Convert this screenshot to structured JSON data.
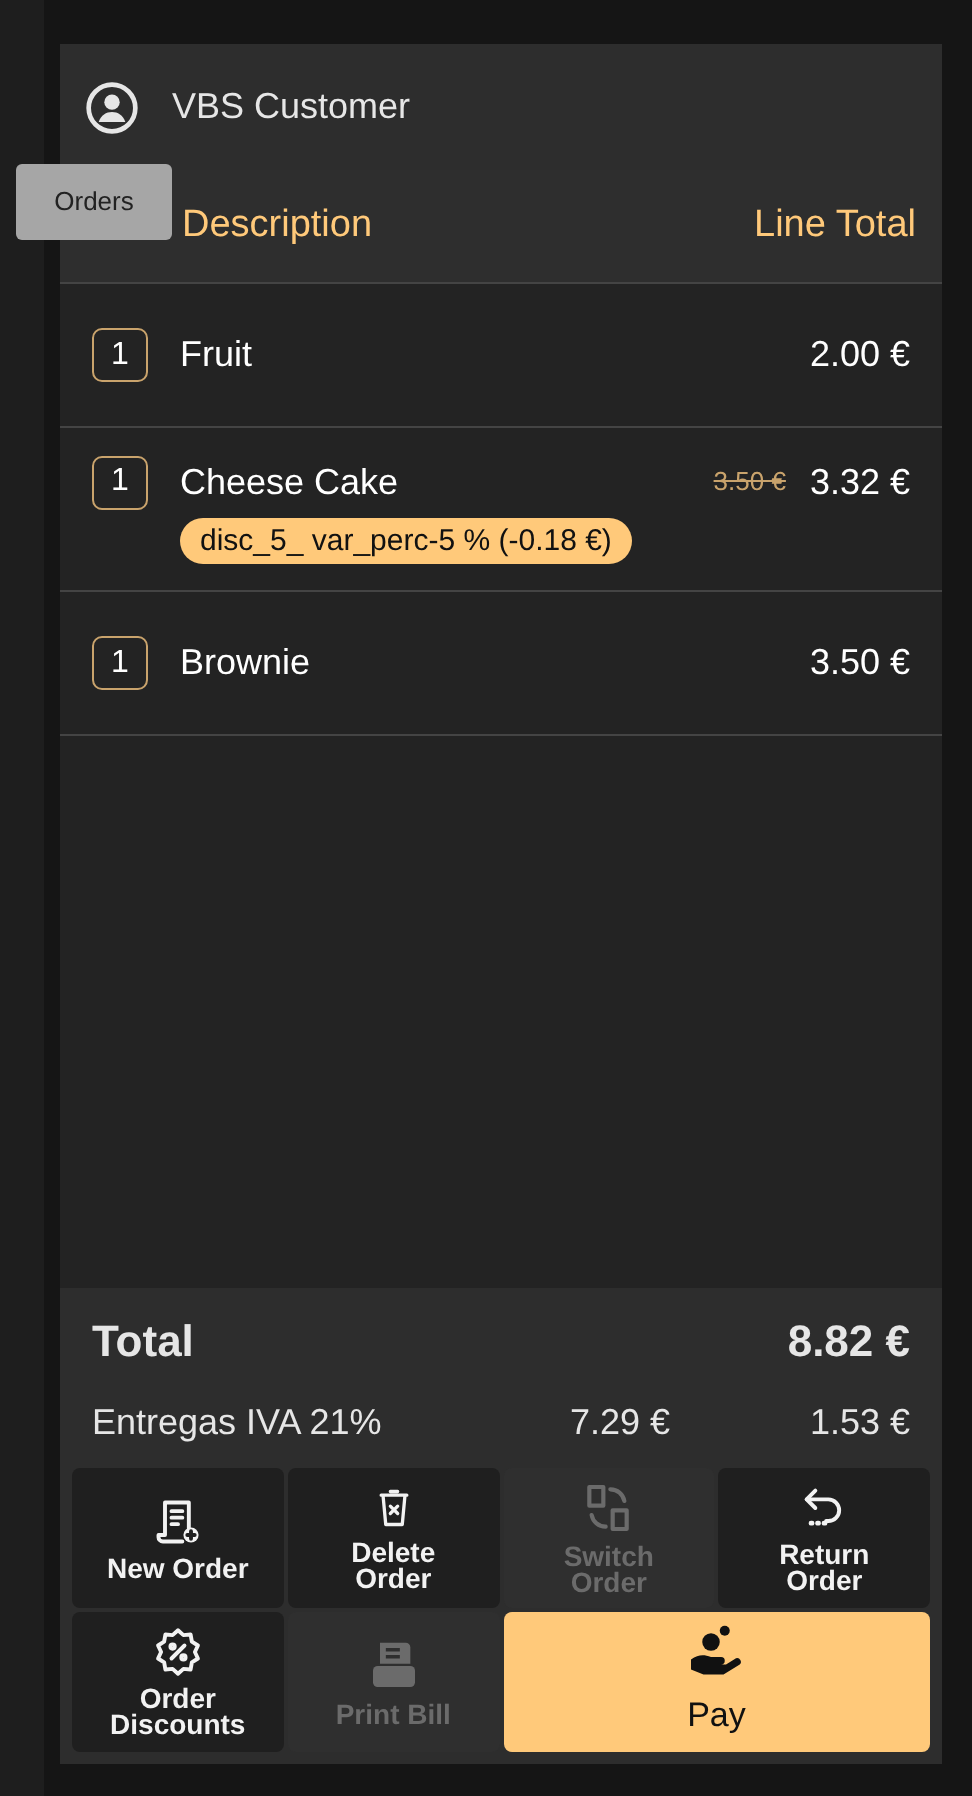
{
  "customer": {
    "name": "VBS Customer"
  },
  "tooltip": {
    "text": "Orders"
  },
  "columns": {
    "description": "Description",
    "line_total": "Line Total"
  },
  "lines": [
    {
      "qty": "1",
      "description": "Fruit",
      "total": "2.00 €"
    },
    {
      "qty": "1",
      "description": "Cheese Cake",
      "original_price": "3.50 €",
      "total": "3.32 €",
      "discount": "disc_5_ var_perc-5 % (-0.18 €)"
    },
    {
      "qty": "1",
      "description": "Brownie",
      "total": "3.50 €"
    }
  ],
  "totals": {
    "label": "Total",
    "amount": "8.82 €"
  },
  "taxes": [
    {
      "label": "Entregas IVA 21%",
      "base": "7.29 €",
      "tax": "1.53 €"
    }
  ],
  "buttons": [
    {
      "kind": "new",
      "label": [
        "New Order"
      ],
      "disabled": false
    },
    {
      "kind": "delete",
      "label": [
        "Delete",
        "Order"
      ],
      "disabled": false
    },
    {
      "kind": "switch",
      "label": [
        "Switch",
        "Order"
      ],
      "disabled": true
    },
    {
      "kind": "return",
      "label": [
        "Return",
        "Order"
      ],
      "disabled": false
    },
    {
      "kind": "discount",
      "label": [
        "Order",
        "Discounts"
      ],
      "disabled": false
    },
    {
      "kind": "print",
      "label": [
        "Print Bill"
      ],
      "disabled": true
    },
    {
      "kind": "pay",
      "label": [
        "Pay"
      ],
      "disabled": false
    }
  ]
}
